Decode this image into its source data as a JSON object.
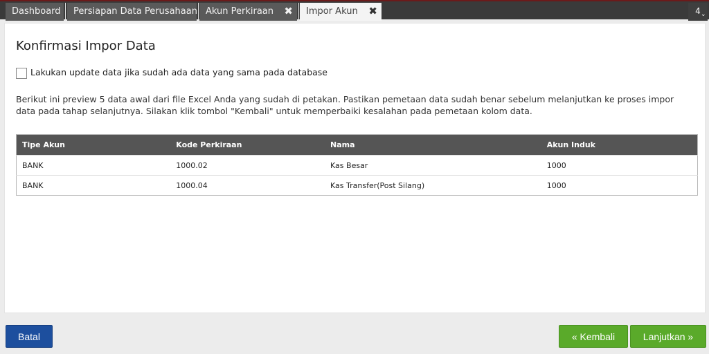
{
  "tabs": [
    {
      "label": "Dashboard"
    },
    {
      "label": "Persiapan Data Perusahaan"
    },
    {
      "label": "Akun Perkiraan",
      "close": "✖"
    },
    {
      "label": "Impor Akun",
      "close": "✖"
    }
  ],
  "tab_counter": {
    "count": "4",
    "icon": "chevron-down-icon"
  },
  "page": {
    "title": "Konfirmasi Impor Data",
    "update_checkbox_label": "Lakukan update data jika sudah ada data yang sama pada database",
    "update_checked": false,
    "description": "Berikut ini preview 5 data awal dari file Excel Anda yang sudah di petakan. Pastikan pemetaan data sudah benar sebelum melanjutkan ke proses impor data pada tahap selanjutnya. Silakan klik tombol \"Kembali\" untuk memperbaiki kesalahan pada pemetaan kolom data."
  },
  "table": {
    "headers": [
      "Tipe Akun",
      "Kode Perkiraan",
      "Nama",
      "Akun Induk"
    ],
    "rows": [
      [
        "BANK",
        "1000.02",
        "Kas Besar",
        "1000"
      ],
      [
        "BANK",
        "1000.04",
        "Kas Transfer(Post Silang)",
        "1000"
      ]
    ]
  },
  "buttons": {
    "cancel": "Batal",
    "back": "« Kembali",
    "next": "Lanjutkan »"
  },
  "colors": {
    "tabbar_bg": "#3a3a3a",
    "primary_blue": "#1d4f9e",
    "success_green": "#5aaa2a",
    "table_header_bg": "#555555"
  }
}
